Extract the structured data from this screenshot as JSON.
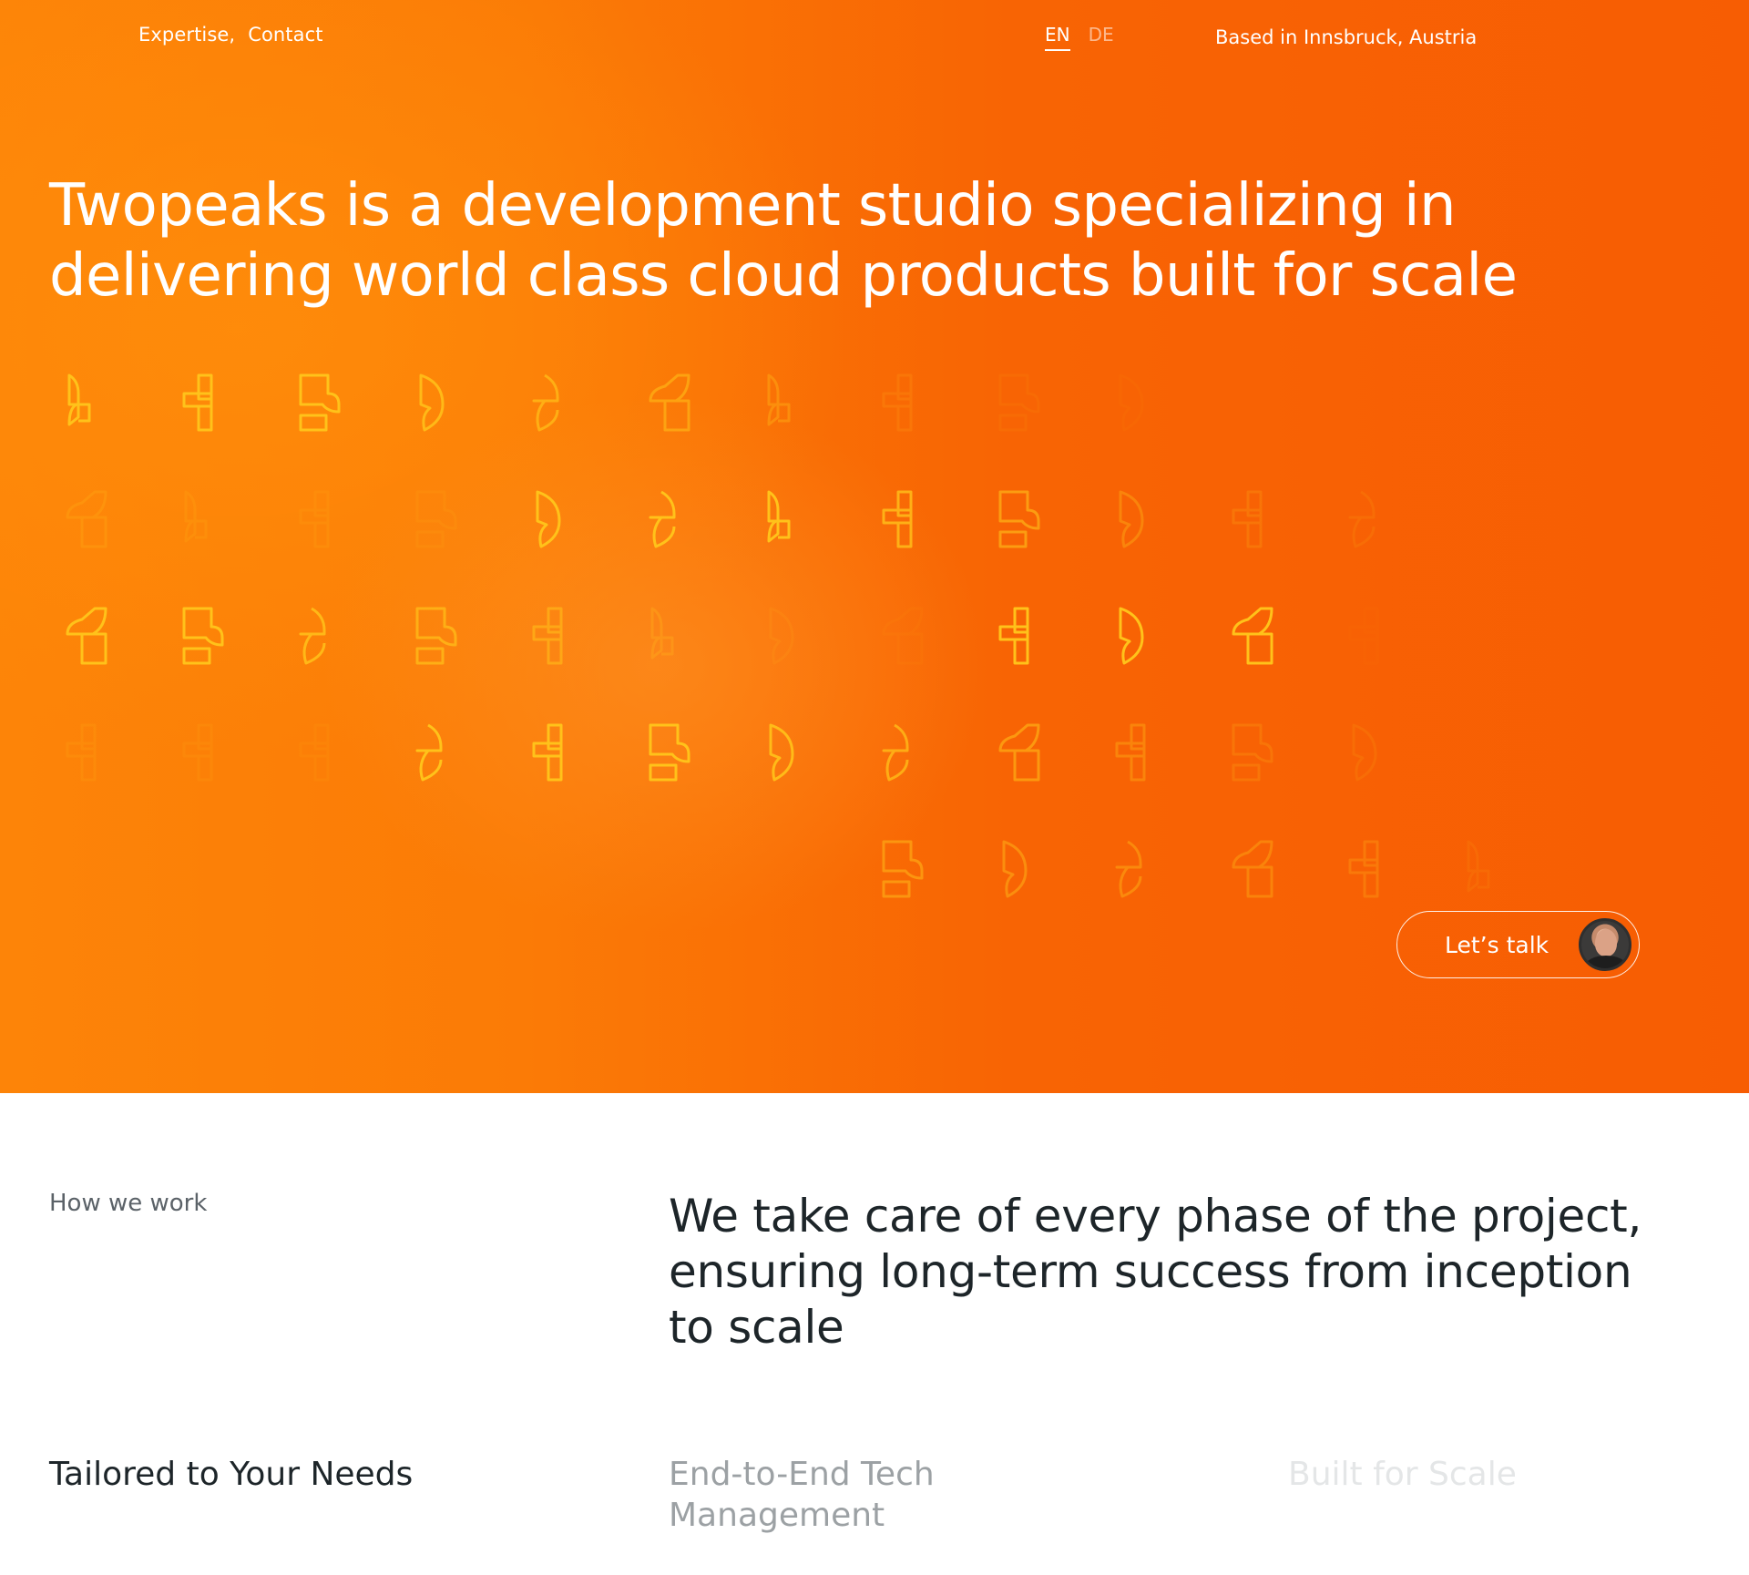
{
  "nav": {
    "links": [
      "Expertise,",
      "Contact"
    ]
  },
  "language": {
    "options": [
      "EN",
      "DE"
    ],
    "active": "EN"
  },
  "location": "Based in Innsbruck, Austria",
  "hero": {
    "headline_line1": "Twopeaks is a development studio specializing in",
    "headline_line2": "delivering world class cloud products built for scale",
    "cta_label": "Let’s talk"
  },
  "how": {
    "label": "How we work",
    "statement": "We take care of every phase of the project, ensuring long-term success from inception to scale"
  },
  "features": [
    "Tailored to Your Needs",
    "End-to-End Tech Management",
    "Built for Scale"
  ],
  "colors": {
    "hero_orange": "#f86404",
    "hero_orange_light": "#fd8408",
    "glyph_yellow": "#ffc21a",
    "text_dark": "#1d2529"
  }
}
